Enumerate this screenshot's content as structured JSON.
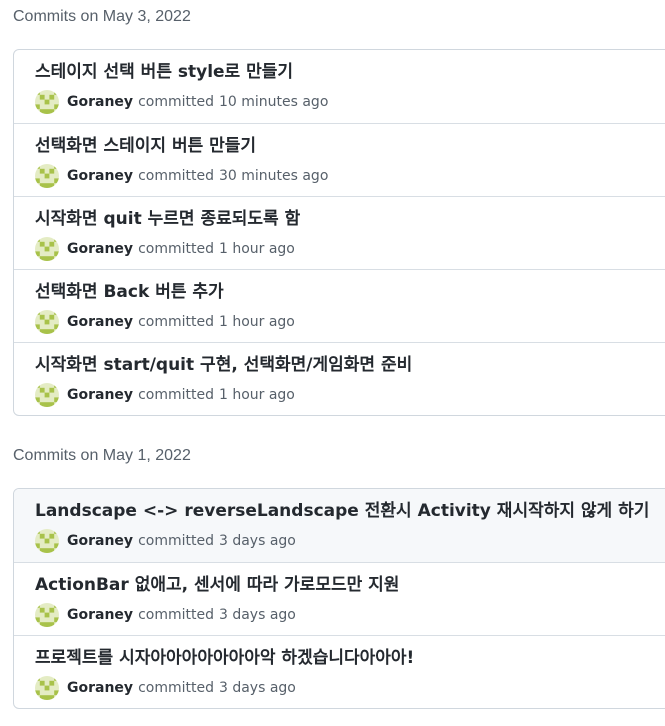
{
  "groups": [
    {
      "heading": "Commits on May 3, 2022",
      "commits": [
        {
          "message": "스테이지 선택 버튼 style로 만들기",
          "author": "Goraney",
          "verb": "committed",
          "time": "10 minutes ago"
        },
        {
          "message": "선택화면 스테이지 버튼 만들기",
          "author": "Goraney",
          "verb": "committed",
          "time": "30 minutes ago"
        },
        {
          "message": "시작화면 quit 누르면 종료되도록 함",
          "author": "Goraney",
          "verb": "committed",
          "time": "1 hour ago"
        },
        {
          "message": "선택화면 Back 버튼 추가",
          "author": "Goraney",
          "verb": "committed",
          "time": "1 hour ago"
        },
        {
          "message": "시작화면 start/quit 구현, 선택화면/게임화면 준비",
          "author": "Goraney",
          "verb": "committed",
          "time": "1 hour ago"
        }
      ]
    },
    {
      "heading": "Commits on May 1, 2022",
      "commits": [
        {
          "message": "Landscape <-> reverseLandscape 전환시 Activity 재시작하지 않게 하기",
          "author": "Goraney",
          "verb": "committed",
          "time": "3 days ago"
        },
        {
          "message": "ActionBar 없애고, 센서에 따라 가로모드만 지원",
          "author": "Goraney",
          "verb": "committed",
          "time": "3 days ago"
        },
        {
          "message": "프로젝트를 시자아아아아아아아악 하겠습니다아아아!",
          "author": "Goraney",
          "verb": "committed",
          "time": "3 days ago"
        }
      ]
    }
  ],
  "colors": {
    "avatar_light": "#e4ecc4",
    "avatar_dark": "#a8c24a"
  }
}
